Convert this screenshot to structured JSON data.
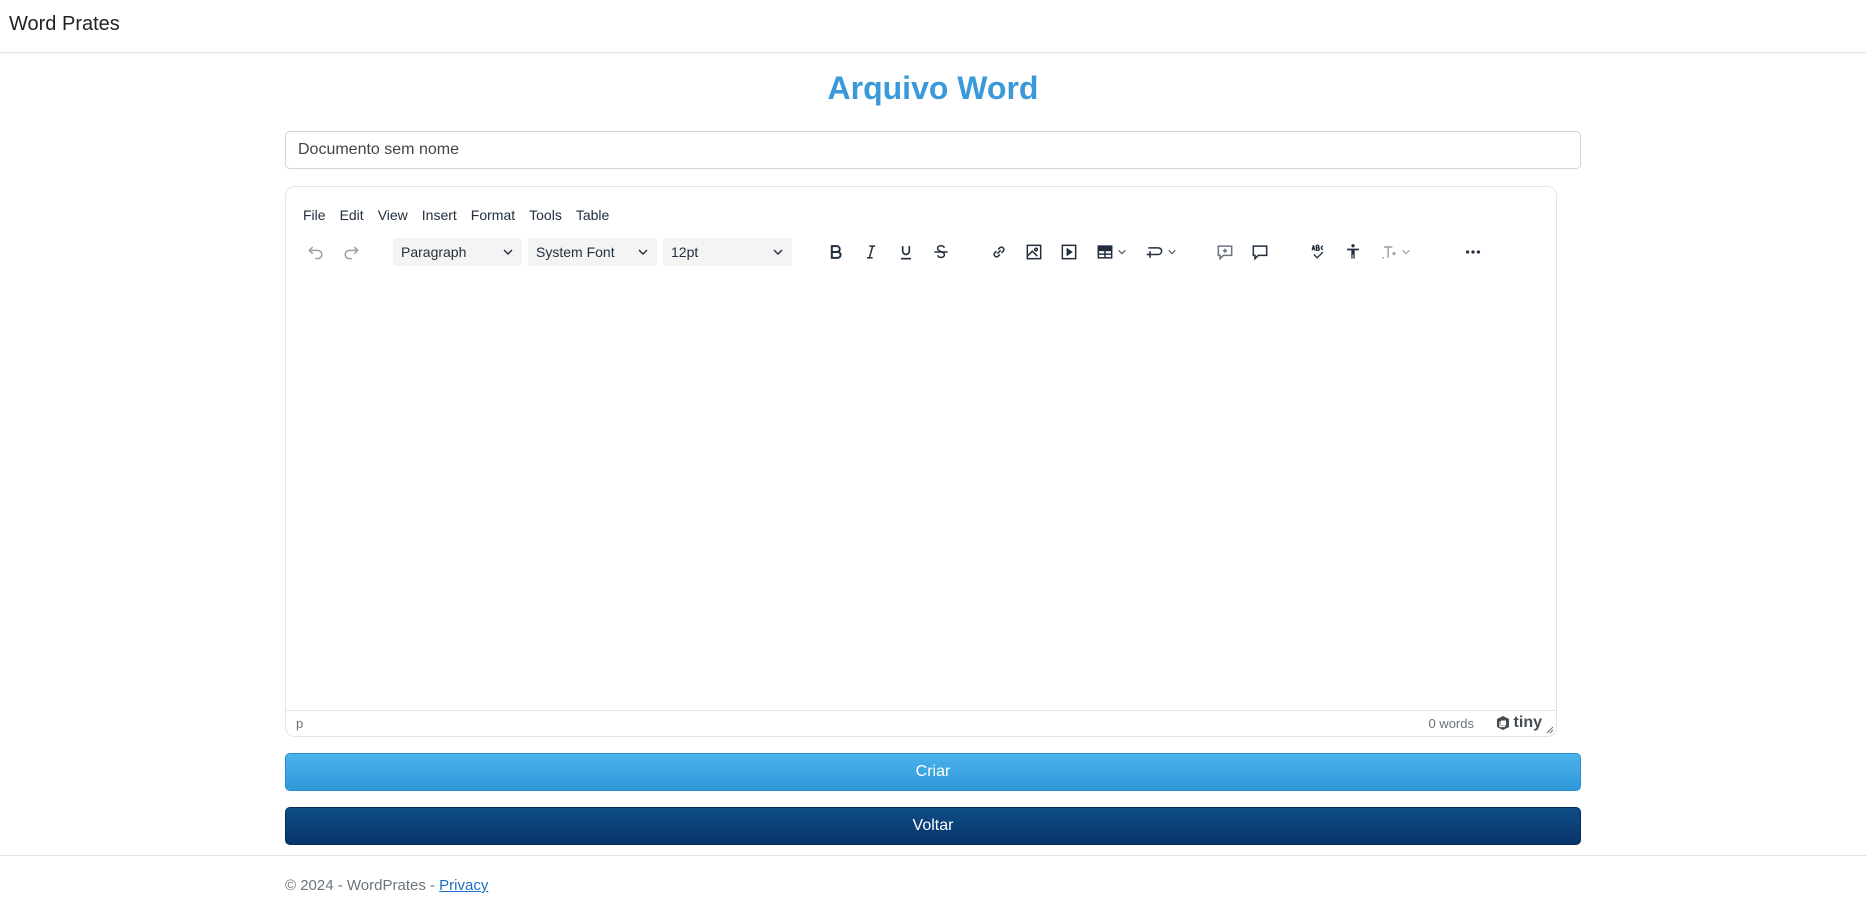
{
  "navbar": {
    "brand": "Word Prates"
  },
  "page": {
    "title": "Arquivo Word"
  },
  "document": {
    "name_value": "Documento sem nome"
  },
  "editor": {
    "menu": [
      "File",
      "Edit",
      "View",
      "Insert",
      "Format",
      "Tools",
      "Table"
    ],
    "block_format": "Paragraph",
    "font_family": "System Font",
    "font_size": "12pt",
    "toolbar_icons": [
      "undo-icon",
      "redo-icon",
      "bold-icon",
      "italic-icon",
      "underline-icon",
      "strikethrough-icon",
      "link-icon",
      "image-icon",
      "media-icon",
      "table-icon",
      "addcomment-icon",
      "comment-icon",
      "spellcheck-icon",
      "accessibility-icon",
      "typography-icon",
      "more-icon"
    ],
    "status_path": "p",
    "word_count": "0 words",
    "brand": "tiny"
  },
  "actions": {
    "create_label": "Criar",
    "back_label": "Voltar"
  },
  "footer": {
    "copyright": "© 2024 - WordPrates - ",
    "privacy_label": "Privacy"
  },
  "colors": {
    "title": "#3a9ad9",
    "create_button": "#3aa6e5",
    "back_button": "#0b3f78"
  }
}
